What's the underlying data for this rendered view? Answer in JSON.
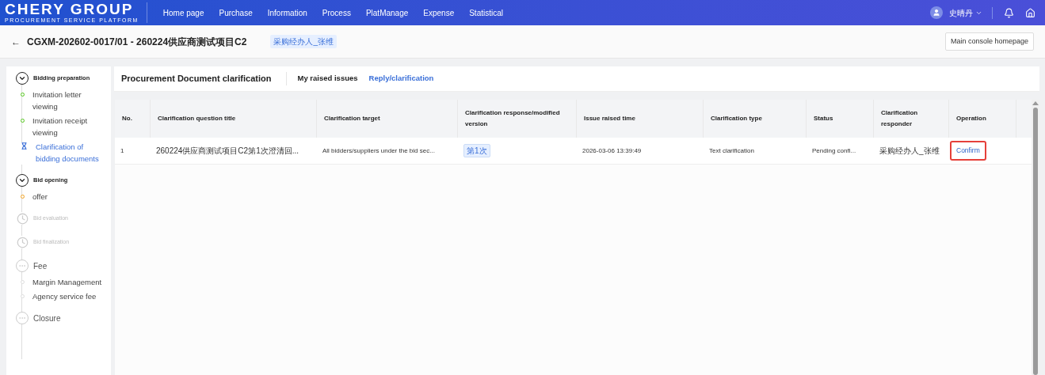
{
  "header": {
    "logo_title": "CHERY GROUP",
    "logo_subtitle": "PROCUREMENT SERVICE PLATFORM",
    "nav": [
      "Home page",
      "Purchase",
      "Information",
      "Process",
      "PlatManage",
      "Expense",
      "Statistical"
    ],
    "user": "史晴丹"
  },
  "title_bar": {
    "back": "←",
    "title": "CGXM-202602-0017/01 - 260224供应商测试项目C2",
    "role_tag": "采购经办人_张维",
    "console_button": "Main console homepage"
  },
  "sidebar": {
    "stages": [
      {
        "label": "Bidding preparation",
        "kind": "open",
        "items": [
          {
            "label": "Invitation letter viewing",
            "kind": "done"
          },
          {
            "label": "Invitation receipt viewing",
            "kind": "done"
          },
          {
            "label": "Clarification of bidding documents",
            "kind": "current"
          }
        ]
      },
      {
        "label": "Bid opening",
        "kind": "open",
        "items": [
          {
            "label": "offer",
            "kind": "waiting"
          }
        ]
      },
      {
        "label": "Bid evaluation",
        "kind": "locked"
      },
      {
        "label": "Bid finalization",
        "kind": "locked"
      },
      {
        "label": "Fee",
        "kind": "idle",
        "items": [
          {
            "label": "Margin Management",
            "kind": "pending"
          },
          {
            "label": "Agency service fee",
            "kind": "pending"
          }
        ]
      },
      {
        "label": "Closure",
        "kind": "idle"
      }
    ]
  },
  "panel": {
    "heading": "Procurement Document clarification",
    "tabs": [
      {
        "label": "My raised issues",
        "selected": false
      },
      {
        "label": "Reply/clarification",
        "selected": true
      }
    ]
  },
  "table": {
    "columns": [
      "No.",
      "Clarification question title",
      "Clarification target",
      "Clarification response/modified version",
      "Issue raised time",
      "Clarification type",
      "Status",
      "Clarification responder",
      "Operation"
    ],
    "rows": [
      {
        "no": "1",
        "title": "260224供应商测试项目C2第1次澄清回...",
        "target": "All bidders/suppliers under the bid sec...",
        "version": "第1次",
        "time": "2026-03-06 13:39:49",
        "type": "Text clarification",
        "status": "Pending confi...",
        "responder": "采购经办人_张维",
        "operation": "Confirm",
        "highlighted": true
      }
    ]
  }
}
